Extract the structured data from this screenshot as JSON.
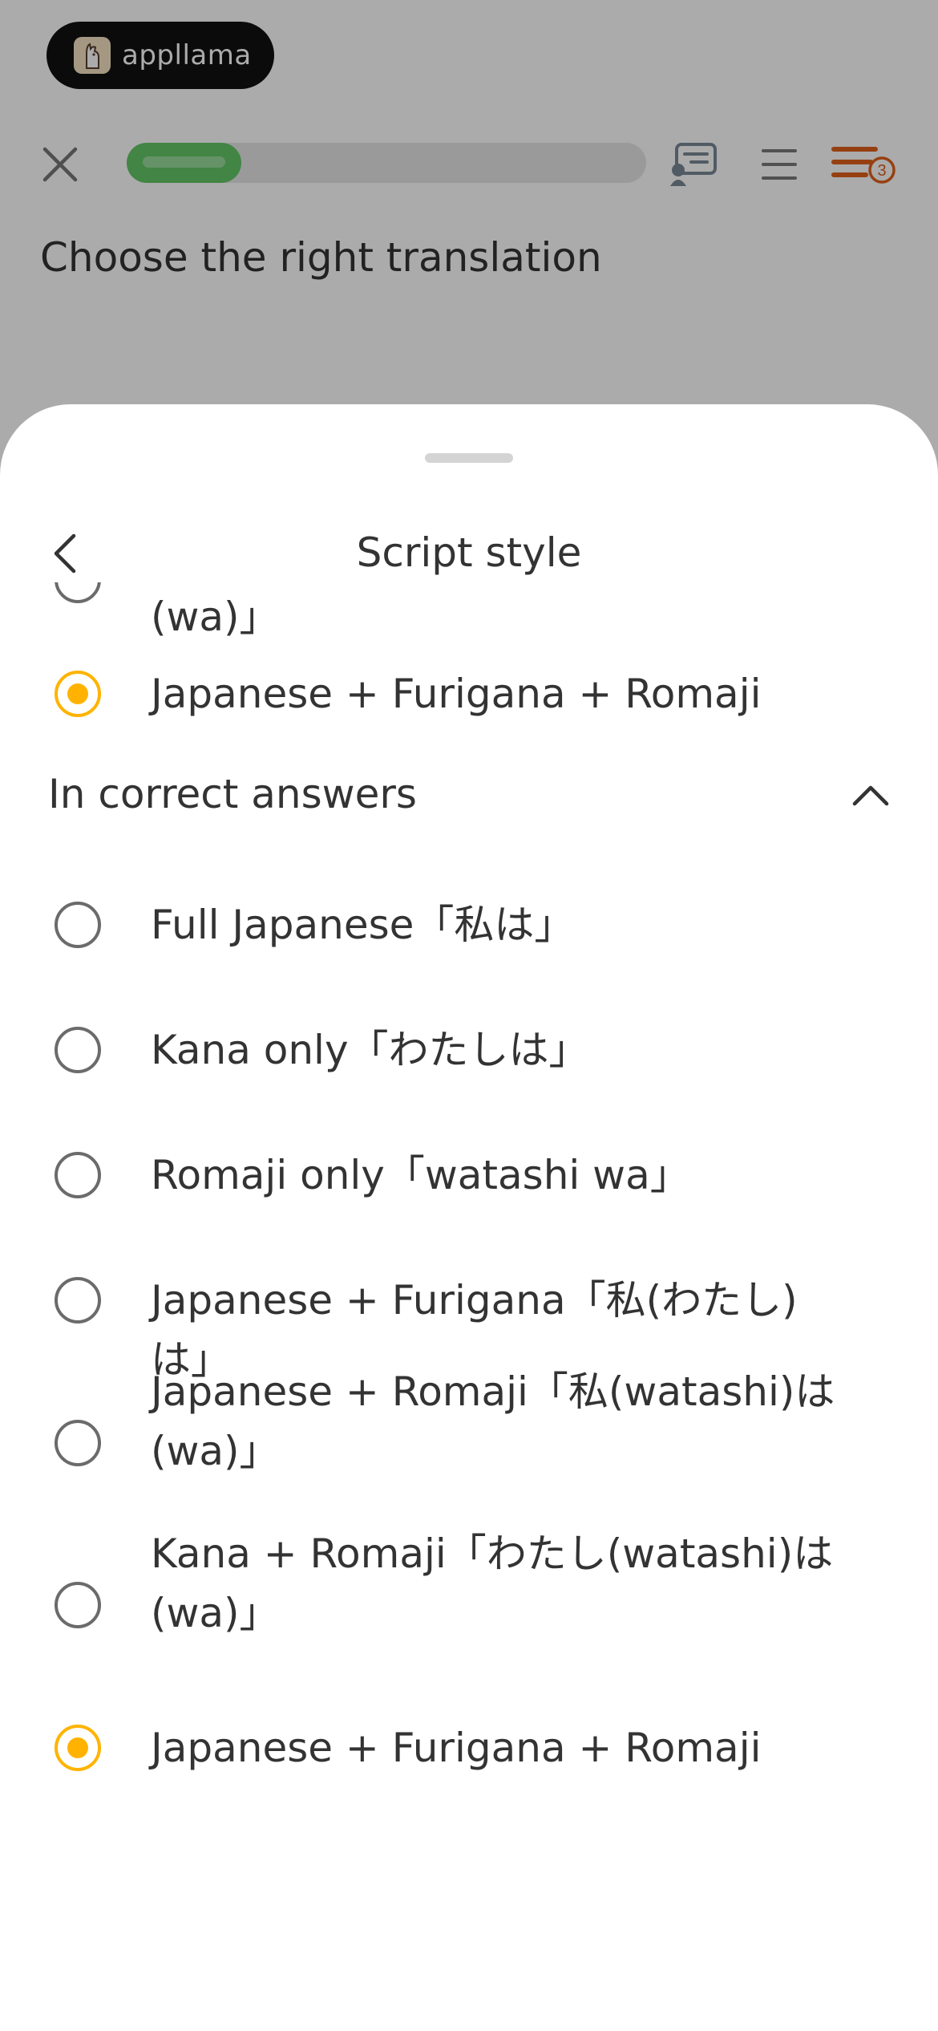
{
  "brand": {
    "name": "appllama",
    "logo_icon": "llama-logo-icon"
  },
  "toolbar": {
    "close_icon": "close-icon",
    "progress_percent": 22,
    "icons": [
      "flashcard-icon",
      "menu-lines-icon",
      "streak-counter-icon"
    ],
    "streak_count": "3"
  },
  "question": {
    "text": "Choose the right translation"
  },
  "sheet": {
    "title": "Script style",
    "back_icon": "chevron-left-icon",
    "top_partial": {
      "label": "(wa)」"
    },
    "top_selected": {
      "label": "Japanese + Furigana + Romaji",
      "checked": true
    },
    "section": {
      "label": "In correct answers",
      "expanded": true,
      "options": [
        {
          "label": "Full Japanese「私は」",
          "checked": false
        },
        {
          "label": "Kana only「わたしは」",
          "checked": false
        },
        {
          "label": "Romaji only「watashi wa」",
          "checked": false
        },
        {
          "label": "Japanese + Furigana「私(わたし)は」",
          "checked": false
        },
        {
          "label": "Japanese + Romaji「私(watashi)は (wa)」",
          "checked": false
        },
        {
          "label": "Kana + Romaji「わたし(watashi)は (wa)」",
          "checked": false
        },
        {
          "label": "Japanese + Furigana + Romaji",
          "checked": true
        }
      ]
    }
  },
  "colors": {
    "accent": "#ffb300",
    "progress": "#63c766",
    "streak": "#e0601a",
    "text": "#333333"
  }
}
